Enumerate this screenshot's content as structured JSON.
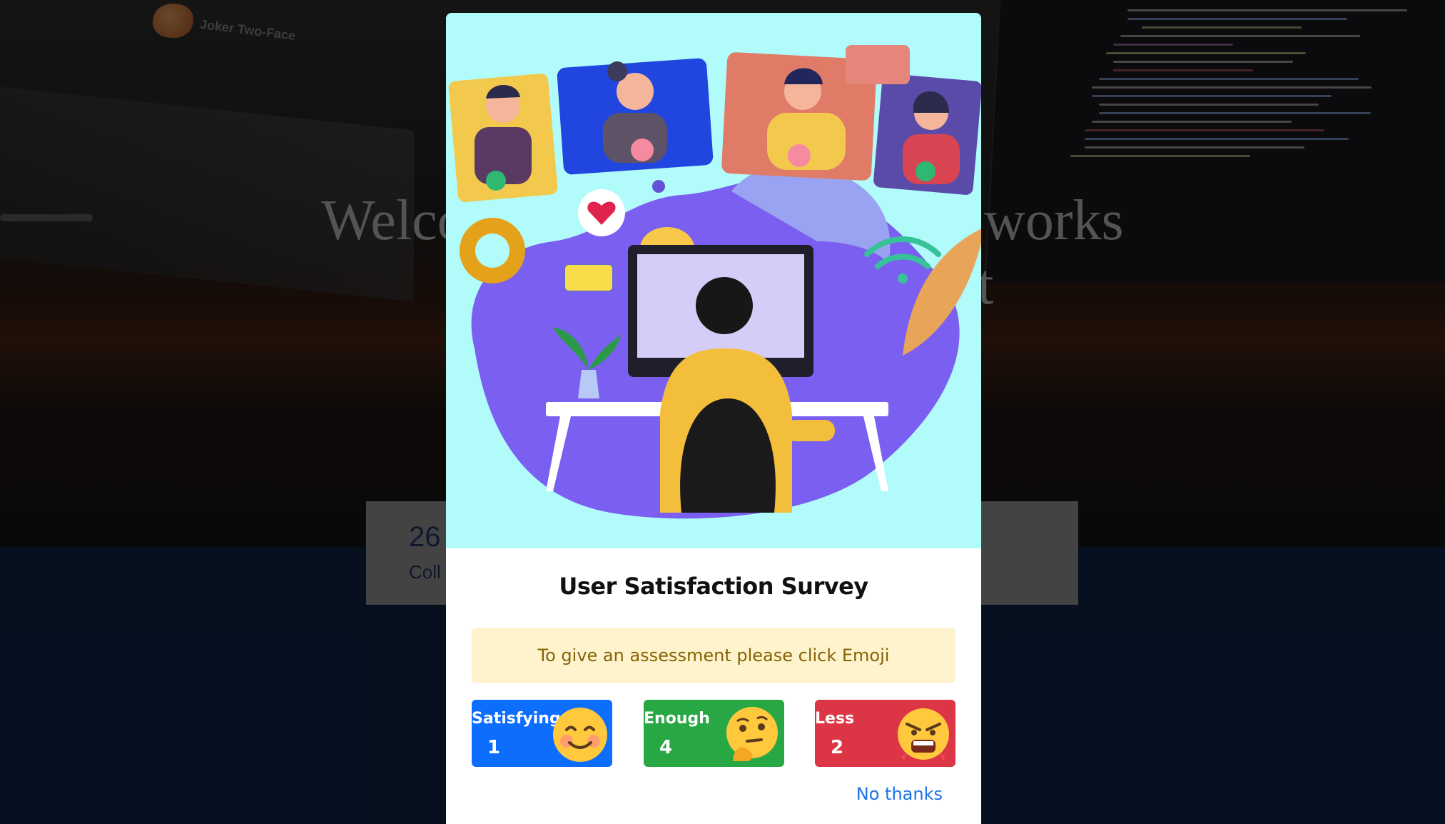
{
  "background": {
    "logo_text": "Joker Two-Face",
    "welcome_line1": "Welcome to the projects and works",
    "welcome_line2": "of Digital Development",
    "stat_number": "26",
    "stat_label": "Coll"
  },
  "modal": {
    "title": "User Satisfaction Survey",
    "instruction": "To give an assessment please click Emoji",
    "choices": [
      {
        "label": "Satisfying",
        "count": "1",
        "emoji": "smiling-face-icon",
        "color": "#0d6efd"
      },
      {
        "label": "Enough",
        "count": "4",
        "emoji": "thinking-face-icon",
        "color": "#28a745"
      },
      {
        "label": "Less",
        "count": "2",
        "emoji": "angry-face-icon",
        "color": "#dc3545"
      }
    ],
    "dismiss_label": "No thanks"
  },
  "colors": {
    "illustration_bg": "#b1fbfb",
    "alert_bg": "#fff3cd",
    "alert_text": "#856404",
    "link": "#1a73e8"
  }
}
